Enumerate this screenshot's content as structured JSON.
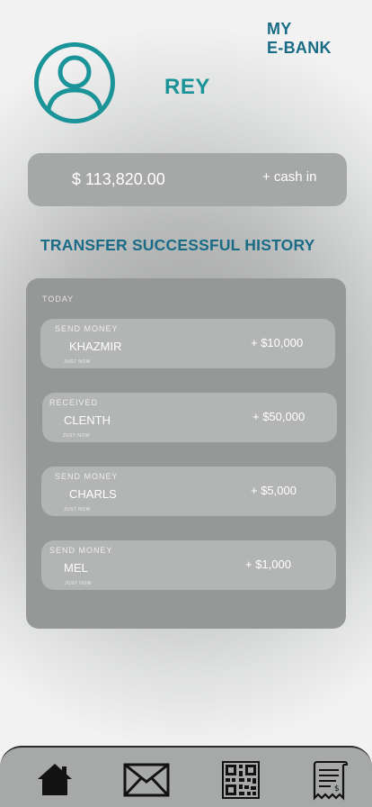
{
  "app": {
    "brand_line1": "MY",
    "brand_line2": "E-BANK"
  },
  "user": {
    "name": "REY"
  },
  "balance": {
    "amount": "$ 113,820.00",
    "cash_in_label": "+ cash in"
  },
  "history": {
    "title": "TRANSFER SUCCESSFUL HISTORY",
    "section_label": "TODAY",
    "transactions": [
      {
        "type": "SEND MONEY",
        "name": "KHAZMIR",
        "time": "JUST NOW",
        "amount": "+ $10,000"
      },
      {
        "type": "RECEIVED",
        "name": "CLENTH",
        "time": "JUST NOW",
        "amount": "+ $50,000"
      },
      {
        "type": "SEND MONEY",
        "name": "CHARLS",
        "time": "JUST NOW",
        "amount": "+ $5,000"
      },
      {
        "type": "SEND MONEY",
        "name": "MEL",
        "time": "JUST NOW",
        "amount": "+ $1,000"
      }
    ]
  },
  "nav": {
    "items": [
      {
        "icon": "home-icon"
      },
      {
        "icon": "mail-icon"
      },
      {
        "icon": "qr-code-icon"
      },
      {
        "icon": "receipt-icon"
      }
    ]
  },
  "colors": {
    "brand": "#1a6c86",
    "accent": "#1a9499",
    "panel": "#969797",
    "card": "#b3b4b4"
  }
}
